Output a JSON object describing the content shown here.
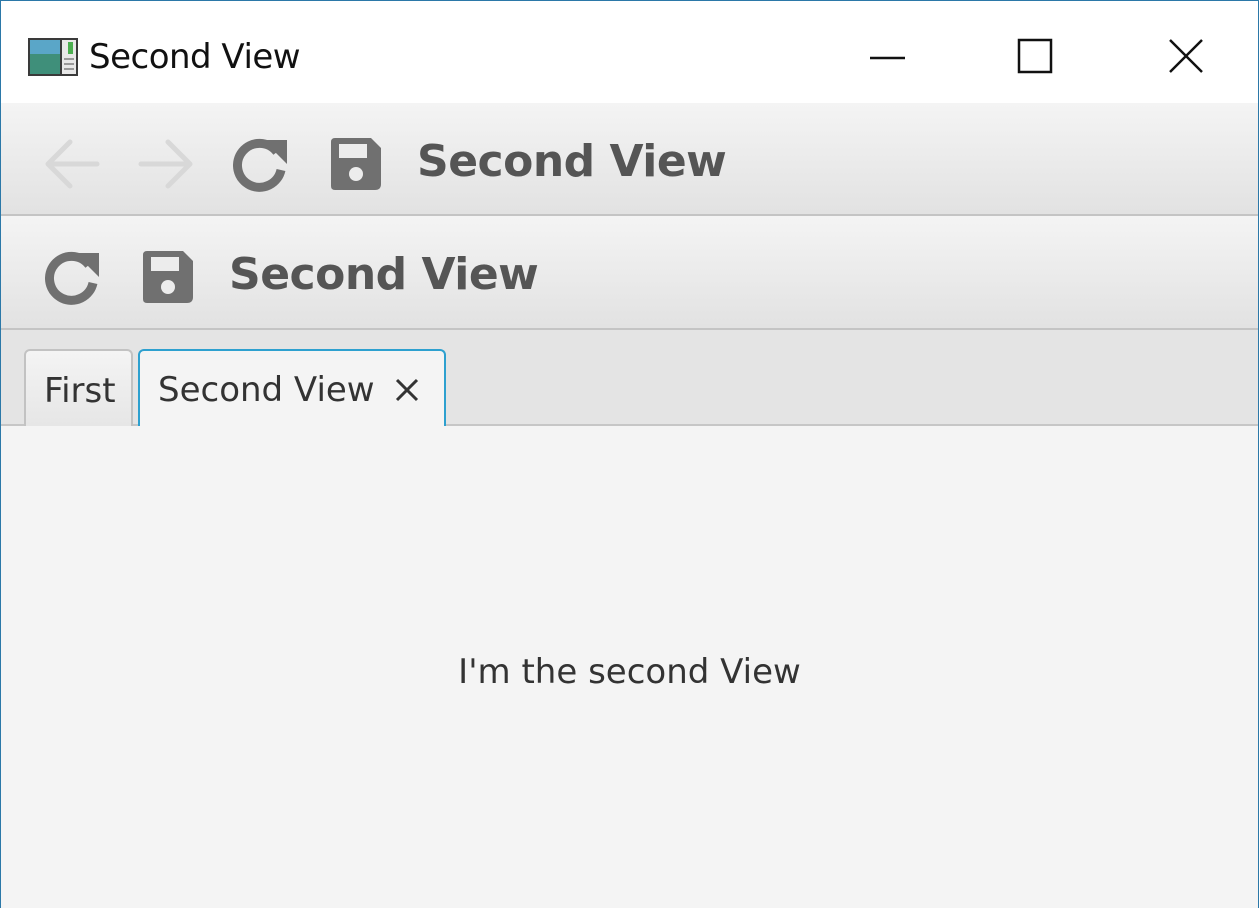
{
  "window": {
    "title": "Second View"
  },
  "toolbar1": {
    "title": "Second View",
    "icons": [
      "back-arrow-icon",
      "forward-arrow-icon",
      "refresh-icon",
      "save-icon"
    ]
  },
  "toolbar2": {
    "title": "Second View",
    "icons": [
      "refresh-icon",
      "save-icon"
    ]
  },
  "tabs": [
    {
      "label": "First",
      "selected": false
    },
    {
      "label": "Second View",
      "selected": true,
      "closable": true
    }
  ],
  "content": {
    "text": "I'm the second View"
  },
  "colors": {
    "accent": "#2da0cf",
    "window_border": "#2b78a8",
    "icon_gray": "#707070",
    "disabled_gray": "#d6d6d6"
  }
}
